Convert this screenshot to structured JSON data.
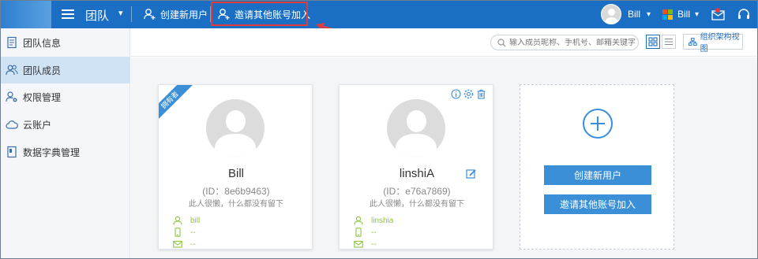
{
  "header": {
    "title": "团队",
    "create_user": "创建新用户",
    "invite_user": "邀请其他账号加入",
    "user_name": "Bill",
    "tenant_name": "Bill"
  },
  "sidebar": {
    "items": [
      {
        "label": "团队信息",
        "icon": "document-icon"
      },
      {
        "label": "团队成员",
        "icon": "users-icon",
        "active": true
      },
      {
        "label": "权限管理",
        "icon": "user-settings-icon"
      },
      {
        "label": "云账户",
        "icon": "cloud-icon"
      },
      {
        "label": "数据字典管理",
        "icon": "book-icon"
      }
    ]
  },
  "toolbar": {
    "search_placeholder": "输入成员昵称、手机号、邮箱关键字",
    "org_view": "组织架构视图"
  },
  "members": [
    {
      "name": "Bill",
      "uid": "(ID：8e6b9463)",
      "bio": "此人很懒，什么都没有留下",
      "account": "bill",
      "phone": "--",
      "email": "--",
      "badge": "拥有者"
    },
    {
      "name": "linshiA",
      "uid": "(ID：e76a7869)",
      "bio": "此人很懒，什么都没有留下",
      "account": "linshia",
      "phone": "--",
      "email": "--"
    }
  ],
  "add_card": {
    "create_user": "创建新用户",
    "invite_user": "邀请其他账号加入"
  },
  "colors": {
    "topbar": "#1a6fc4",
    "accent": "#3a8fd6",
    "highlight": "#e23b3b",
    "info_green": "#8cc63f"
  }
}
